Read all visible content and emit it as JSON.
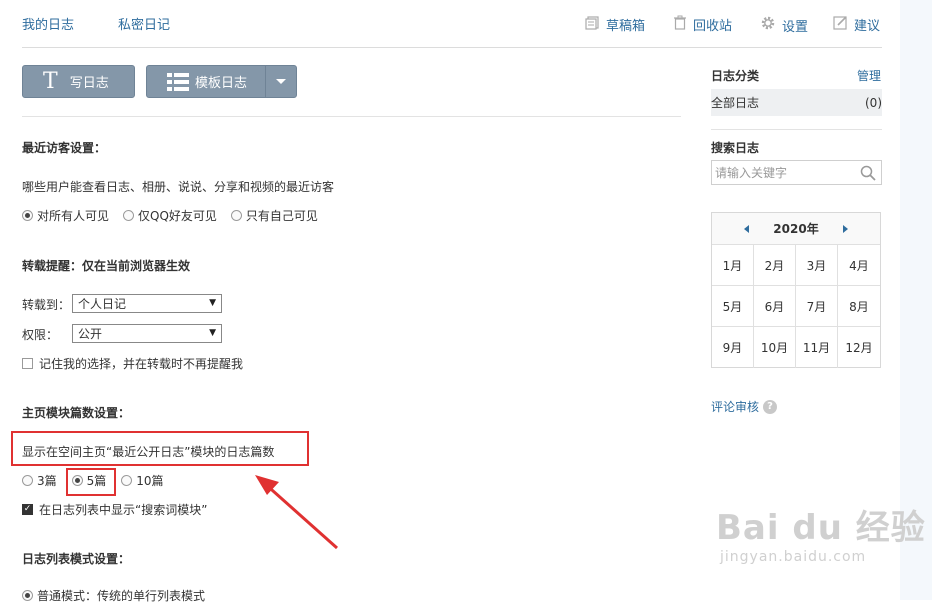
{
  "nav": {
    "tabs": [
      "我的日志",
      "私密日记"
    ]
  },
  "header": {
    "drafts": "草稿箱",
    "recycle": "回收站",
    "settings": "设置",
    "suggest": "建议"
  },
  "toolbar": {
    "write": "写日志",
    "template": "模板日志"
  },
  "visitors": {
    "title": "最近访客设置：",
    "desc": "哪些用户能查看日志、相册、说说、分享和视频的最近访客",
    "options": [
      "对所有人可见",
      "仅QQ好友可见",
      "只有自己可见"
    ],
    "selected": "对所有人可见"
  },
  "repost": {
    "title": "转载提醒：仅在当前浏览器生效",
    "to_label": "转载到：",
    "to_value": "个人日记",
    "perm_label": "权限：",
    "perm_value": "公开",
    "remember": "记住我的选择，并在转载时不再提醒我",
    "remember_checked": false
  },
  "homepage": {
    "title": "主页模块篇数设置：",
    "desc": "显示在空间主页“最近公开日志”模块的日志篇数",
    "options": [
      "3篇",
      "5篇",
      "10篇"
    ],
    "selected": "5篇",
    "show_search": "在日志列表中显示“搜索词模块”",
    "show_search_checked": true
  },
  "listmode": {
    "title": "日志列表模式设置：",
    "option": "普通模式：传统的单行列表模式",
    "selected": true
  },
  "sidebar": {
    "cat_title": "日志分类",
    "manage": "管理",
    "cat_all": "全部日志",
    "cat_count": "(0)",
    "search_title": "搜索日志",
    "search_placeholder": "请输入关键字",
    "year": "2020年",
    "months": [
      "1月",
      "2月",
      "3月",
      "4月",
      "5月",
      "6月",
      "7月",
      "8月",
      "9月",
      "10月",
      "11月",
      "12月"
    ],
    "comment_review": "评论审核",
    "help": "?"
  },
  "watermark": {
    "main": "Bai du 经验",
    "sub": "jingyan.baidu.com"
  },
  "colors": {
    "link": "#2f6d9e",
    "button": "#8497a9",
    "annotation": "#e03131"
  }
}
